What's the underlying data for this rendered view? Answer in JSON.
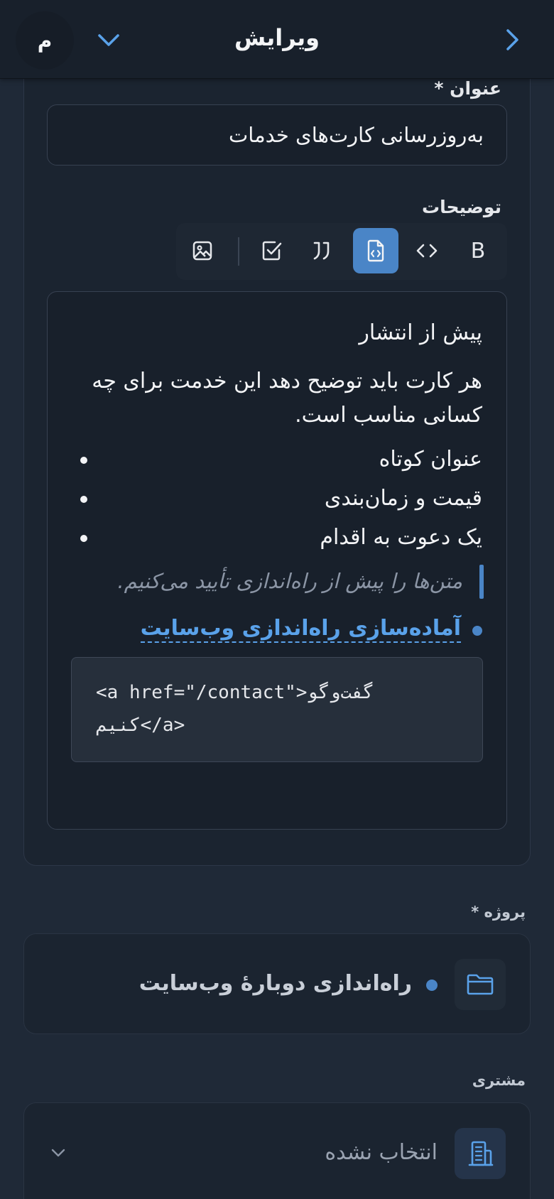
{
  "header": {
    "title": "ویرایش",
    "avatar_initial": "م"
  },
  "form": {
    "title_label": "عنوان *",
    "title_value": "به‌روزرسانی کارت‌های خدمات",
    "description_label": "توضیحات",
    "toolbar": {
      "buttons": [
        "bold-icon",
        "code-icon",
        "code-block-icon",
        "quote-icon",
        "checkbox-icon",
        "image-icon"
      ],
      "active": "code-block-icon",
      "bold_glyph": "B"
    },
    "editor": {
      "heading": "پیش از انتشار",
      "paragraph": "هر کارت باید توضیح دهد این خدمت برای چه کسانی مناسب است.",
      "list": [
        "عنوان کوتاه",
        "قیمت و زمان‌بندی",
        "یک دعوت به اقدام"
      ],
      "quote": "متن‌ها را پیش از راه‌اندازی تأیید می‌کنیم.",
      "task_link": "آماده‌سازی راه‌اندازی وب‌سایت",
      "code_line_1": "<a href=\"/contact\">گفت‌وگو",
      "code_line_2": "کنیم</a>"
    },
    "project_label": "پروژه *",
    "project_value": "راه‌اندازی دوبارهٔ وب‌سایت",
    "client_label": "مشتری",
    "client_value": "انتخاب نشده"
  },
  "colors": {
    "accent": "#4a85c7",
    "background": "#1f2937",
    "header": "#18202b"
  }
}
